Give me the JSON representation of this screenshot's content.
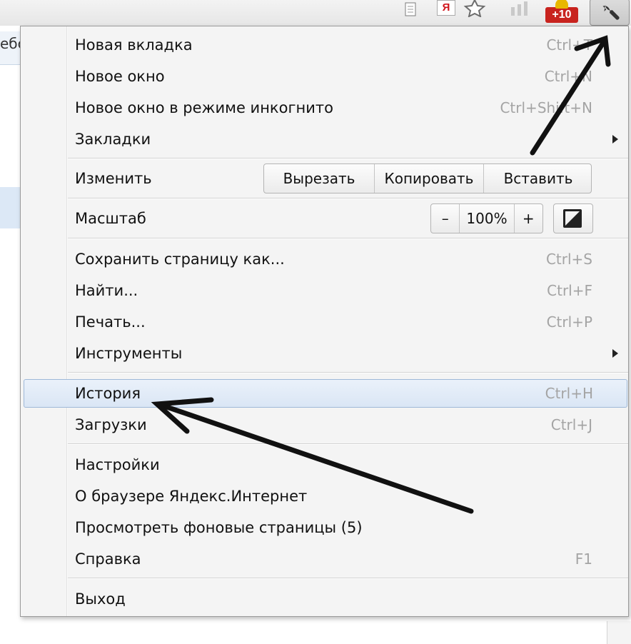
{
  "browser_behind": {
    "fragment_text": "ебс"
  },
  "toolbar": {
    "icons": [
      "page-icon",
      "yandex-icon",
      "star-icon",
      "bars-icon",
      "gplus-icon",
      "wrench-icon"
    ],
    "yandex_letter": "Я",
    "gplus_badge": "+10"
  },
  "menu": {
    "items": [
      {
        "id": "new-tab",
        "label": "Новая вкладка",
        "shortcut": "Ctrl+T"
      },
      {
        "id": "new-window",
        "label": "Новое окно",
        "shortcut": "Ctrl+N"
      },
      {
        "id": "incognito",
        "label": "Новое окно в режиме инкогнито",
        "shortcut": "Ctrl+Shift+N"
      },
      {
        "id": "bookmarks",
        "label": "Закладки",
        "submenu": true
      }
    ],
    "edit": {
      "label": "Изменить",
      "buttons": [
        "Вырезать",
        "Копировать",
        "Вставить"
      ]
    },
    "zoom": {
      "label": "Масштаб",
      "minus": "–",
      "value": "100%",
      "plus": "+"
    },
    "items2": [
      {
        "id": "save-page",
        "label": "Сохранить страницу как...",
        "shortcut": "Ctrl+S"
      },
      {
        "id": "find",
        "label": "Найти...",
        "shortcut": "Ctrl+F"
      },
      {
        "id": "print",
        "label": "Печать...",
        "shortcut": "Ctrl+P"
      },
      {
        "id": "tools",
        "label": "Инструменты",
        "submenu": true
      }
    ],
    "items3": [
      {
        "id": "history",
        "label": "История",
        "shortcut": "Ctrl+H",
        "highlighted": true
      },
      {
        "id": "downloads",
        "label": "Загрузки",
        "shortcut": "Ctrl+J"
      }
    ],
    "items4": [
      {
        "id": "settings",
        "label": "Настройки"
      },
      {
        "id": "about",
        "label": "О браузере Яндекс.Интернет"
      },
      {
        "id": "background-pages",
        "label": "Просмотреть фоновые страницы (5)"
      },
      {
        "id": "help",
        "label": "Справка",
        "shortcut": "F1"
      }
    ],
    "items5": [
      {
        "id": "exit",
        "label": "Выход"
      }
    ]
  },
  "colors": {
    "menu_bg": "#f4f4f4",
    "highlight_bg": "#dae6f5",
    "highlight_border": "#9eb8d8",
    "shortcut_text": "#a4a4a4",
    "badge_red": "#c8231e",
    "annotation_arrow": "#111111"
  }
}
